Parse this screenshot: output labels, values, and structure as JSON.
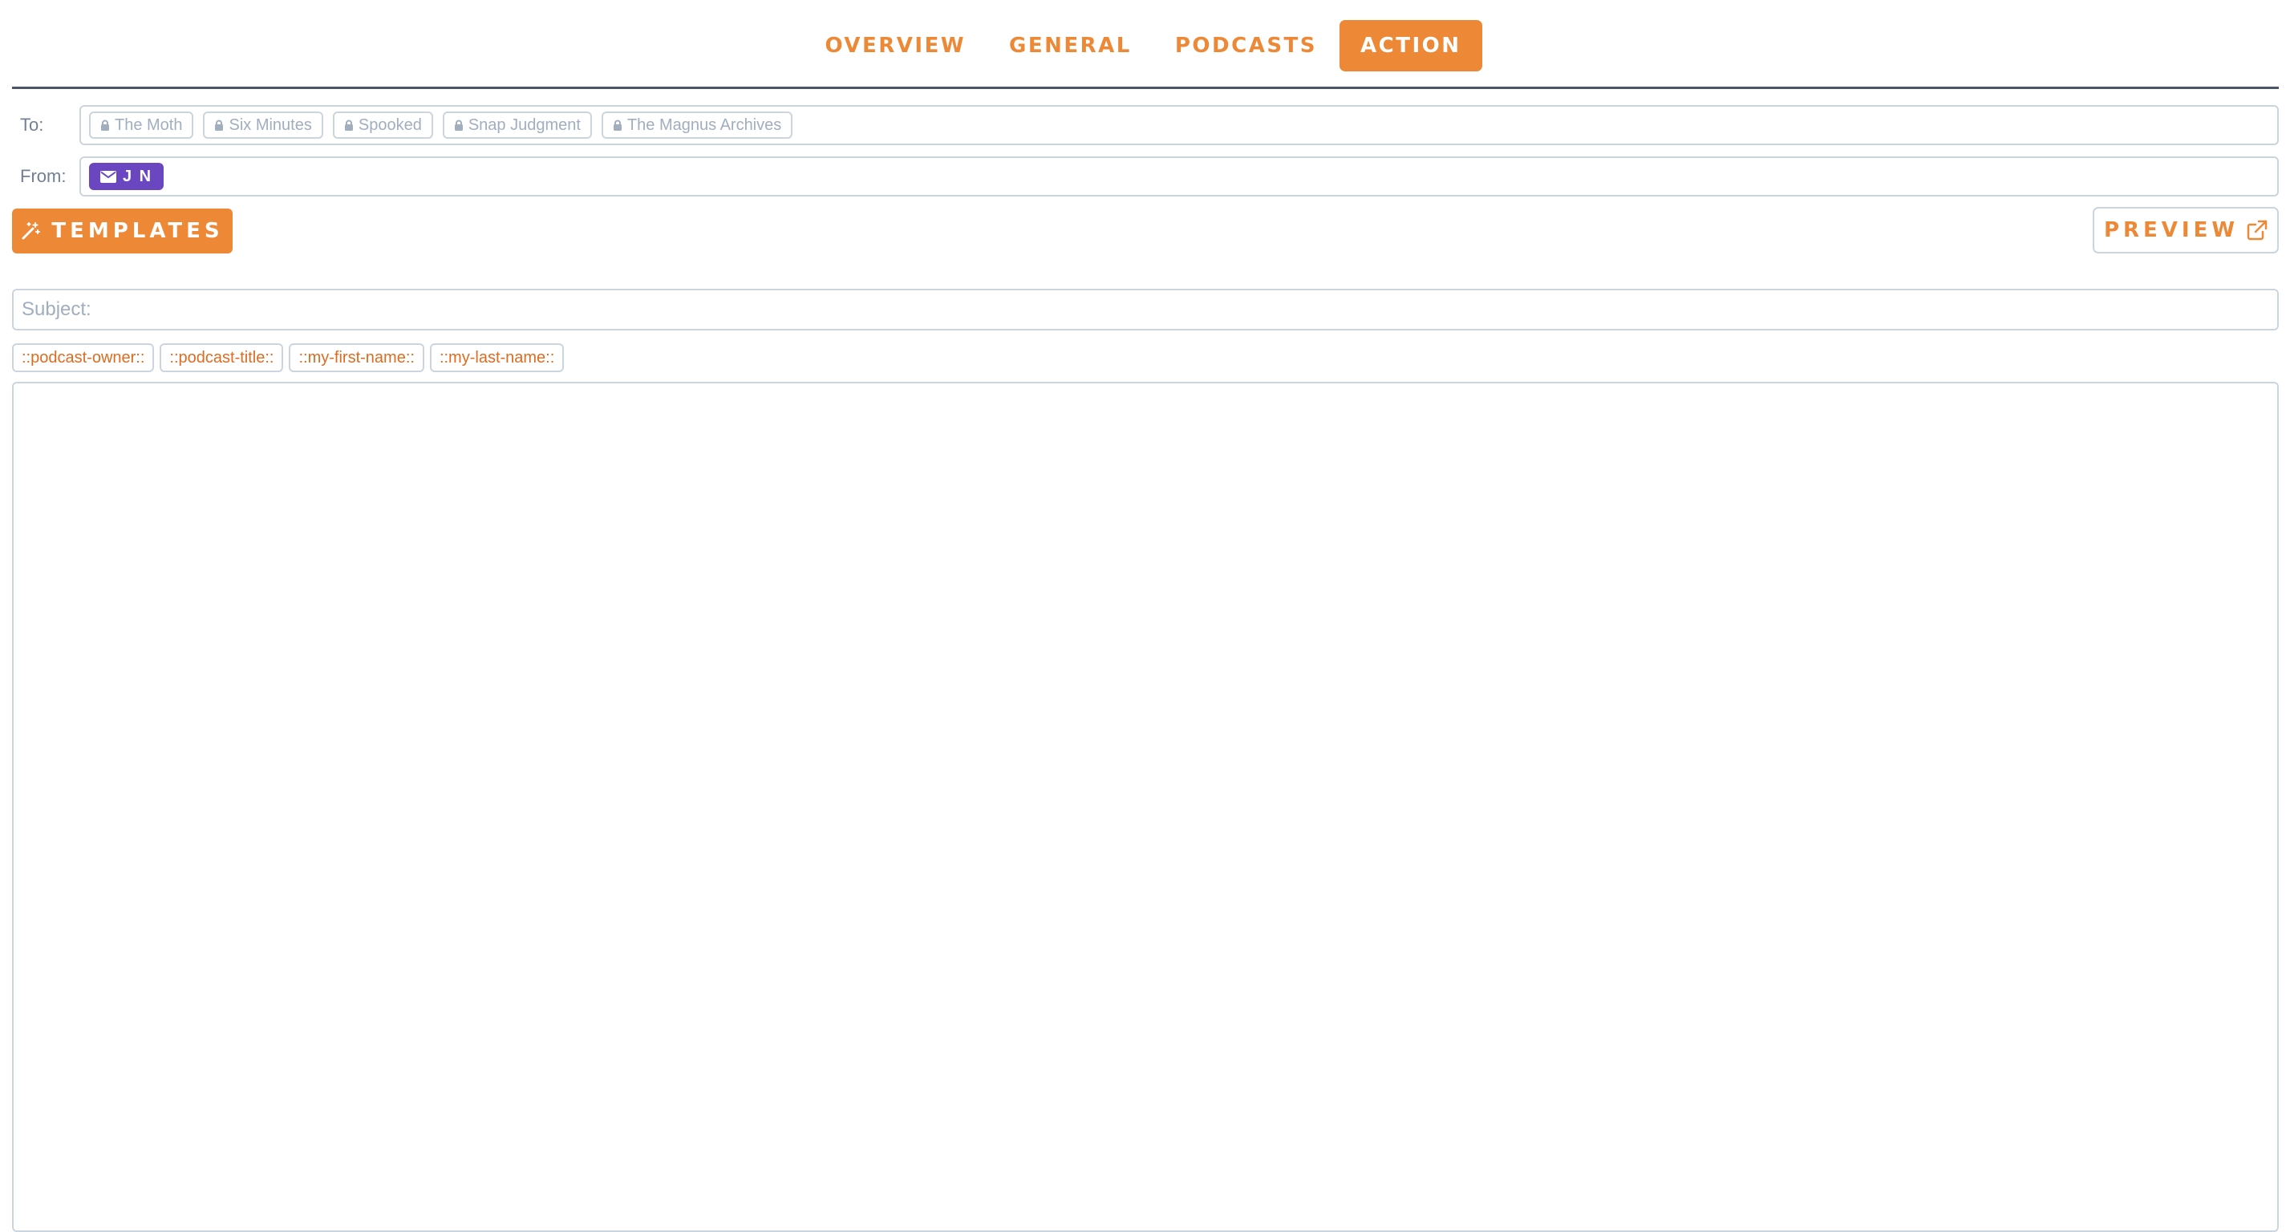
{
  "tabs": [
    {
      "label": "OVERVIEW",
      "active": false
    },
    {
      "label": "GENERAL",
      "active": false
    },
    {
      "label": "PODCASTS",
      "active": false
    },
    {
      "label": "ACTION",
      "active": true
    }
  ],
  "to": {
    "label": "To:",
    "recipients": [
      "The Moth",
      "Six Minutes",
      "Spooked",
      "Snap Judgment",
      "The Magnus Archives"
    ]
  },
  "from": {
    "label": "From:",
    "sender": "J N"
  },
  "toolbar": {
    "templates_label": "TEMPLATES",
    "preview_label": "PREVIEW"
  },
  "subject": {
    "value": "",
    "placeholder": "Subject:"
  },
  "tokens": [
    "::podcast-owner::",
    "::podcast-title::",
    "::my-first-name::",
    "::my-last-name::"
  ],
  "body": {
    "value": ""
  },
  "colors": {
    "accent": "#ed8936",
    "sender_chip": "#6b46c1",
    "border": "#cbd5e0",
    "muted_text": "#a0aec0"
  },
  "icons": {
    "recipient_chip": "lock-icon",
    "sender_chip": "envelope-icon",
    "templates_button": "magic-wand-icon",
    "preview_button": "external-link-icon"
  }
}
